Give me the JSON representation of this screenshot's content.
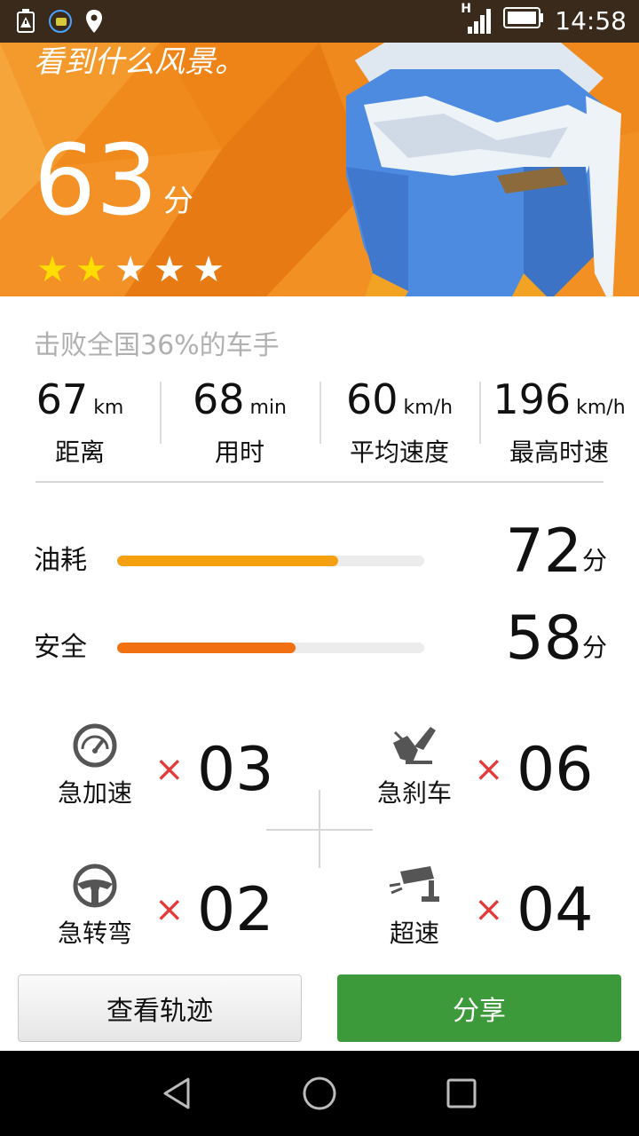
{
  "status_bar": {
    "time": "14:58",
    "network_label": "H",
    "icons": [
      "sim-warning-icon",
      "chat-app-icon",
      "location-pin-icon",
      "signal-icon",
      "battery-icon"
    ]
  },
  "hero": {
    "tagline": "看到什么风景。",
    "score": "63",
    "score_unit": "分",
    "stars_filled": 2,
    "stars_total": 5,
    "colors": {
      "background": "#f08a1c",
      "star_filled": "#ffdd00",
      "star_empty": "#ffffff"
    }
  },
  "beat_text": "击败全国36%的车手",
  "stats": [
    {
      "value": "67",
      "unit": "km",
      "label": "距离"
    },
    {
      "value": "68",
      "unit": "min",
      "label": "用时"
    },
    {
      "value": "60",
      "unit": "km/h",
      "label": "平均速度"
    },
    {
      "value": "196",
      "unit": "km/h",
      "label": "最高时速"
    }
  ],
  "metrics": [
    {
      "label": "油耗",
      "score": "72",
      "unit": "分",
      "progress": 0.72,
      "color": "#f5a00f"
    },
    {
      "label": "安全",
      "score": "58",
      "unit": "分",
      "progress": 0.58,
      "color": "#f07012"
    }
  ],
  "events": [
    {
      "label": "急加速",
      "multiplier": "×",
      "count": "03",
      "icon": "speedometer-icon"
    },
    {
      "label": "急刹车",
      "multiplier": "×",
      "count": "06",
      "icon": "brake-icon"
    },
    {
      "label": "急转弯",
      "multiplier": "×",
      "count": "02",
      "icon": "steering-wheel-icon"
    },
    {
      "label": "超速",
      "multiplier": "×",
      "count": "04",
      "icon": "speed-camera-icon"
    }
  ],
  "buttons": {
    "view_track": "查看轨迹",
    "share": "分享",
    "share_color": "#3d9a3a"
  },
  "nav": [
    "back-icon",
    "home-icon",
    "recents-icon"
  ]
}
